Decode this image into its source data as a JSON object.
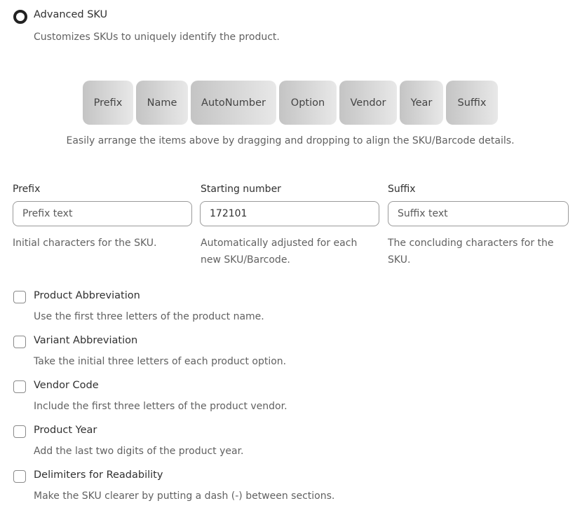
{
  "option": {
    "label": "Advanced SKU",
    "description": "Customizes SKUs to uniquely identify the product.",
    "selected": true
  },
  "chips": [
    "Prefix",
    "Name",
    "AutoNumber",
    "Option",
    "Vendor",
    "Year",
    "Suffix"
  ],
  "chips_hint": "Easily arrange the items above by dragging and dropping to align the SKU/Barcode details.",
  "fields": [
    {
      "label": "Prefix",
      "value": "",
      "placeholder": "Prefix text",
      "help": "Initial characters for the SKU."
    },
    {
      "label": "Starting number",
      "value": "172101",
      "placeholder": "",
      "help": "Automatically adjusted for each new SKU/Barcode."
    },
    {
      "label": "Suffix",
      "value": "",
      "placeholder": "Suffix text",
      "help": "The concluding characters for the SKU."
    }
  ],
  "checkboxes": [
    {
      "label": "Product Abbreviation",
      "description": "Use the first three letters of the product name.",
      "checked": false
    },
    {
      "label": "Variant Abbreviation",
      "description": "Take the initial three letters of each product option.",
      "checked": false
    },
    {
      "label": "Vendor Code",
      "description": "Include the first three letters of the product vendor.",
      "checked": false
    },
    {
      "label": "Product Year",
      "description": "Add the last two digits of the product year.",
      "checked": false
    },
    {
      "label": "Delimiters for Readability",
      "description": "Make the SKU clearer by putting a dash (-) between sections.",
      "checked": false
    }
  ]
}
